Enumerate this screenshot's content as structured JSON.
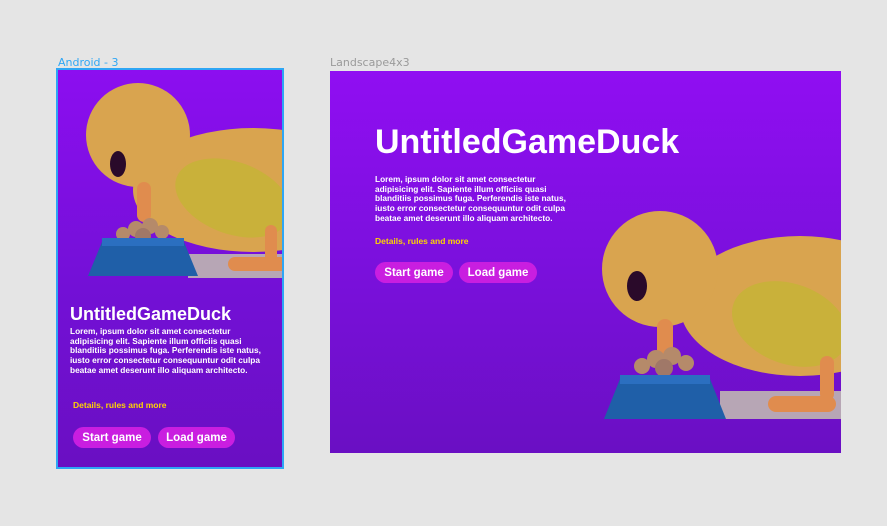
{
  "frames": {
    "android": {
      "label": "Android - 3"
    },
    "landscape": {
      "label": "Landscape4x3"
    }
  },
  "game": {
    "title": "UntitledGameDuck",
    "description": "Lorem, ipsum dolor sit amet consectetur adipisicing elit. Sapiente illum officiis quasi blanditiis possimus fuga. Perferendis iste natus, iusto error consectetur consequuntur odit culpa beatae amet deserunt illo aliquam architecto.",
    "details_link": "Details, rules and more",
    "start_label": "Start game",
    "load_label": "Load game"
  },
  "colors": {
    "android_label": "#2ea6f5",
    "landscape_label": "#9a9a9a",
    "accent_link": "#ffd400",
    "button": "#c91ee0",
    "duck_body": "#e8b24a",
    "bowl": "#1f5fa8"
  }
}
